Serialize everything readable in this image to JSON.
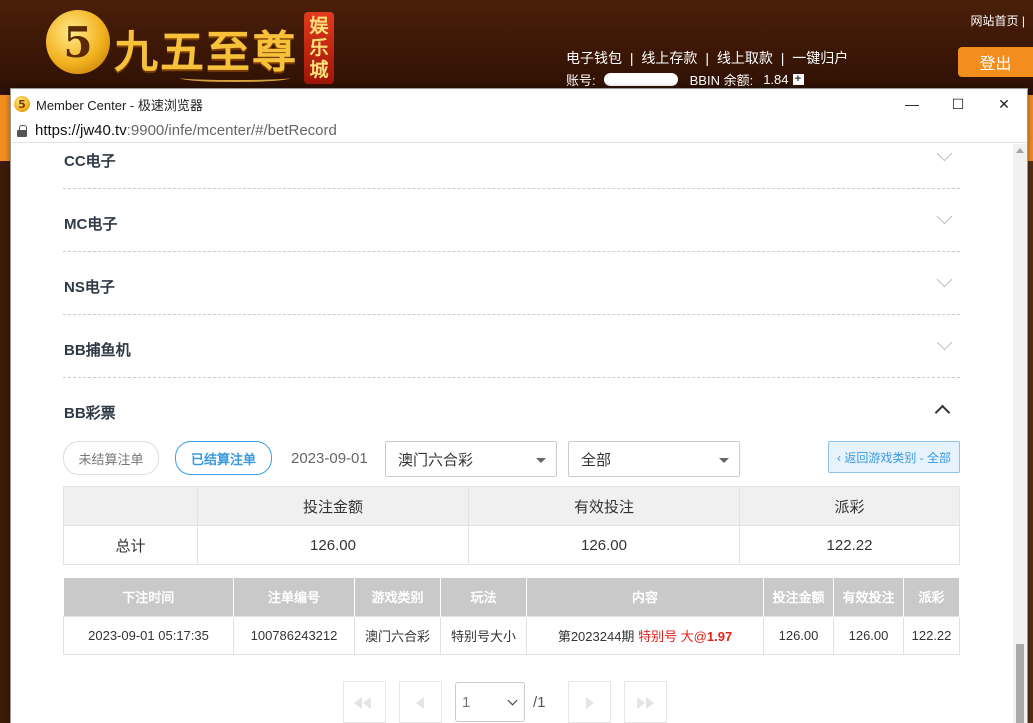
{
  "site": {
    "brand_text": "九五至尊",
    "badge_chars": [
      "娱",
      "乐",
      "城"
    ],
    "logo_glyph": "5",
    "top_link": "网站首页 |",
    "wallet_links": [
      "电子钱包",
      "|",
      "线上存款",
      "|",
      "线上取款",
      "|",
      "一键归户"
    ],
    "account_label": "账号:",
    "balance_label": "BBIN 余额:",
    "balance_value": "1.84",
    "plus_glyph": "+",
    "logout_label": "登出"
  },
  "browser": {
    "title": "Member Center - 极速浏览器",
    "url_host": "https://jw40.tv",
    "url_rest": ":9900/infe/mcenter/#/betRecord",
    "logo_glyph": "5",
    "minimize_glyph": "—",
    "maximize_glyph": "☐",
    "close_glyph": "✕"
  },
  "accordion": {
    "items": [
      {
        "title": "CC电子"
      },
      {
        "title": "MC电子"
      },
      {
        "title": "NS电子"
      },
      {
        "title": "BB捕鱼机"
      }
    ],
    "expanded_title": "BB彩票"
  },
  "filters": {
    "unsettled_label": "未结算注单",
    "settled_label": "已结算注单",
    "date": "2023-09-01",
    "game_select": "澳门六合彩",
    "type_select": "全部",
    "back_label": "‹ 返回游戏类别 - 全部"
  },
  "summary": {
    "headers": [
      "",
      "投注金额",
      "有效投注",
      "派彩"
    ],
    "row": {
      "label": "总计",
      "bet": "126.00",
      "valid": "126.00",
      "payout": "122.22"
    }
  },
  "detail": {
    "headers": [
      "下注时间",
      "注单编号",
      "游戏类别",
      "玩法",
      "内容",
      "投注金额",
      "有效投注",
      "派彩"
    ],
    "rows": [
      {
        "time": "2023-09-01 05:17:35",
        "order_no": "100786243212",
        "game": "澳门六合彩",
        "play": "特别号大小",
        "content_period": "第2023244期",
        "content_pick": "特别号 大@",
        "content_odds": "1.97",
        "bet": "126.00",
        "valid": "126.00",
        "payout": "122.22"
      }
    ]
  },
  "pagination": {
    "current_page": "1",
    "total_label": "/1"
  },
  "colors": {
    "accent_blue": "#3a9ae0",
    "logout_orange": "#f38d1e",
    "highlight_red": "#e0241b"
  }
}
